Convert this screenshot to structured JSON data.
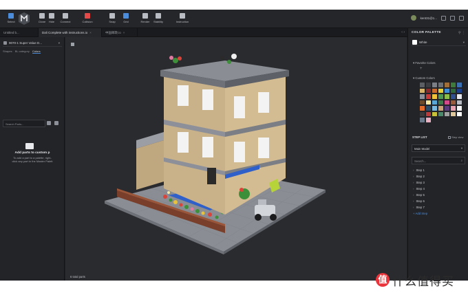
{
  "toolbar": {
    "buttons": [
      {
        "label": "Select",
        "color": "#4c8ddb"
      },
      {
        "label": "Clone",
        "color": "#b9bcc3"
      },
      {
        "label": "Hide",
        "color": "#b9bcc3"
      },
      {
        "label": "Connect",
        "color": "#b9bcc3"
      },
      {
        "label": "Collision",
        "color": "#e24a4a"
      },
      {
        "label": "Snap",
        "color": "#b9bcc3"
      },
      {
        "label": "Grid",
        "color": "#4c8ddb"
      },
      {
        "label": "Render",
        "color": "#b9bcc3"
      },
      {
        "label": "Stability",
        "color": "#b9bcc3"
      },
      {
        "label": "Instruction",
        "color": "#b9bcc3"
      }
    ],
    "user_name": "kent31@1..."
  },
  "tabs": [
    {
      "label": "Untitled b..."
    },
    {
      "label": "Dali Complete with instructions.io",
      "close": "×"
    },
    {
      "label": "中国邮政.io",
      "close": "×"
    }
  ],
  "left_panel": {
    "set_name": "9070-1 Super Value D...",
    "part_tabs": [
      "Shapes",
      "BL category",
      "Colors"
    ],
    "search_placeholder": "Search Parts...",
    "add_title": "Add parts to custom p",
    "add_desc": "To add a part to a palette, right-click any part in the Master Palett"
  },
  "viewport": {
    "status": "6 total parts"
  },
  "right_panel": {
    "title": "COLOR PALETTE",
    "selected_color": "White",
    "favorite_label": "Favorite Colors",
    "fav_add": "+",
    "custom_label": "Custom Colors",
    "swatches": [
      "#5b5e63",
      "#3a3c41",
      "#7b7e84",
      "#6b6f76",
      "#a36f38",
      "#3e7a3a",
      "#3a6fb2",
      "#d7b36a",
      "#8b2a2a",
      "#c86b2c",
      "#e8d23a",
      "#3f8fd8",
      "#2f6a3d",
      "#1b3f8b",
      "#8d9099",
      "#c63a3a",
      "#f0c23a",
      "#4d9a55",
      "#8cbf4a",
      "#2f4f8f",
      "#e8e9ec",
      "#6a4a2a",
      "#f3e6a0",
      "#58a6d6",
      "#3d7a4a",
      "#d44a8a",
      "#9a5a3a",
      "#b9bcc3",
      "#e06a2a",
      "#2a4a6a",
      "#7ab8e0",
      "#c9a27a",
      "#5a3a7a",
      "#e8a0b0",
      "#f5f5f5",
      "#3a3a3a",
      "#b83a3a",
      "#c8c23a",
      "#4a8a6a",
      "#a0a0a0",
      "#e0c89a",
      "#ffffff",
      "#6a7a8a",
      "#e8b0c0"
    ],
    "step_list_label": "STEP LIST",
    "step_view_label": "Step view",
    "model_select": "Main Model",
    "step_search_placeholder": "Search...",
    "steps": [
      "Step 1",
      "Step 2",
      "Step 3",
      "Step 4",
      "Step 5",
      "Step 6",
      "Step 7"
    ],
    "add_step": "+ Add Step"
  },
  "watermark": {
    "logo_glyph": "值",
    "text": "什么值得买"
  }
}
